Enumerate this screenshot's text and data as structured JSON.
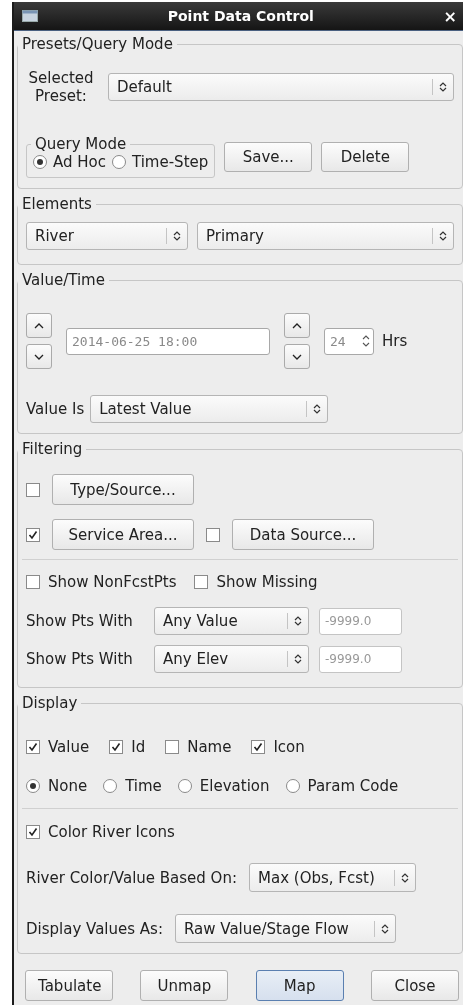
{
  "window": {
    "title": "Point Data Control",
    "close": "×"
  },
  "presets": {
    "legend": "Presets/Query Mode",
    "label": "Selected Preset:",
    "preset": "Default",
    "query_mode": {
      "legend": "Query Mode",
      "options": [
        {
          "label": "Ad Hoc",
          "selected": true
        },
        {
          "label": "Time-Step",
          "selected": false
        }
      ]
    },
    "buttons": [
      "Save...",
      "Delete"
    ]
  },
  "elements": {
    "legend": "Elements",
    "type": "River",
    "subtype": "Primary"
  },
  "value_time": {
    "legend": "Value/Time",
    "datetime": {
      "value": "2014-06-25 18:00",
      "disabled": true
    },
    "hours": {
      "value": "24",
      "disabled": true
    },
    "hours_unit": "Hrs",
    "value_is_label": "Value Is",
    "value_is": "Latest Value"
  },
  "filtering": {
    "legend": "Filtering",
    "filters": [
      {
        "label": "Type/Source...",
        "checked": false
      },
      {
        "label": "Service Area...",
        "checked": true
      },
      {
        "label": "Data Source...",
        "checked": false
      }
    ],
    "options": [
      {
        "label": "Show NonFcstPts",
        "checked": false
      },
      {
        "label": "Show Missing",
        "checked": false
      }
    ],
    "show_with": [
      {
        "label": "Show Pts With",
        "choice": "Any Value",
        "threshold": "-9999.0",
        "disabled": true
      },
      {
        "label": "Show Pts With",
        "choice": "Any Elev",
        "threshold": "-9999.0",
        "disabled": true
      }
    ]
  },
  "display": {
    "legend": "Display",
    "fields": [
      {
        "label": "Value",
        "checked": true
      },
      {
        "label": "Id",
        "checked": true
      },
      {
        "label": "Name",
        "checked": false
      },
      {
        "label": "Icon",
        "checked": true
      }
    ],
    "label_mode": [
      {
        "label": "None",
        "selected": true
      },
      {
        "label": "Time",
        "selected": false
      },
      {
        "label": "Elevation",
        "selected": false
      },
      {
        "label": "Param Code",
        "selected": false
      }
    ],
    "color_river_icons": {
      "label": "Color River Icons",
      "checked": true
    },
    "based_on_label": "River Color/Value Based On:",
    "based_on": "Max (Obs, Fcst)",
    "values_as_label": "Display Values As:",
    "values_as": "Raw Value/Stage Flow"
  },
  "buttons": [
    {
      "label": "Tabulate",
      "default": false
    },
    {
      "label": "Unmap",
      "default": false
    },
    {
      "label": "Map",
      "default": true
    },
    {
      "label": "Close",
      "default": false
    }
  ]
}
